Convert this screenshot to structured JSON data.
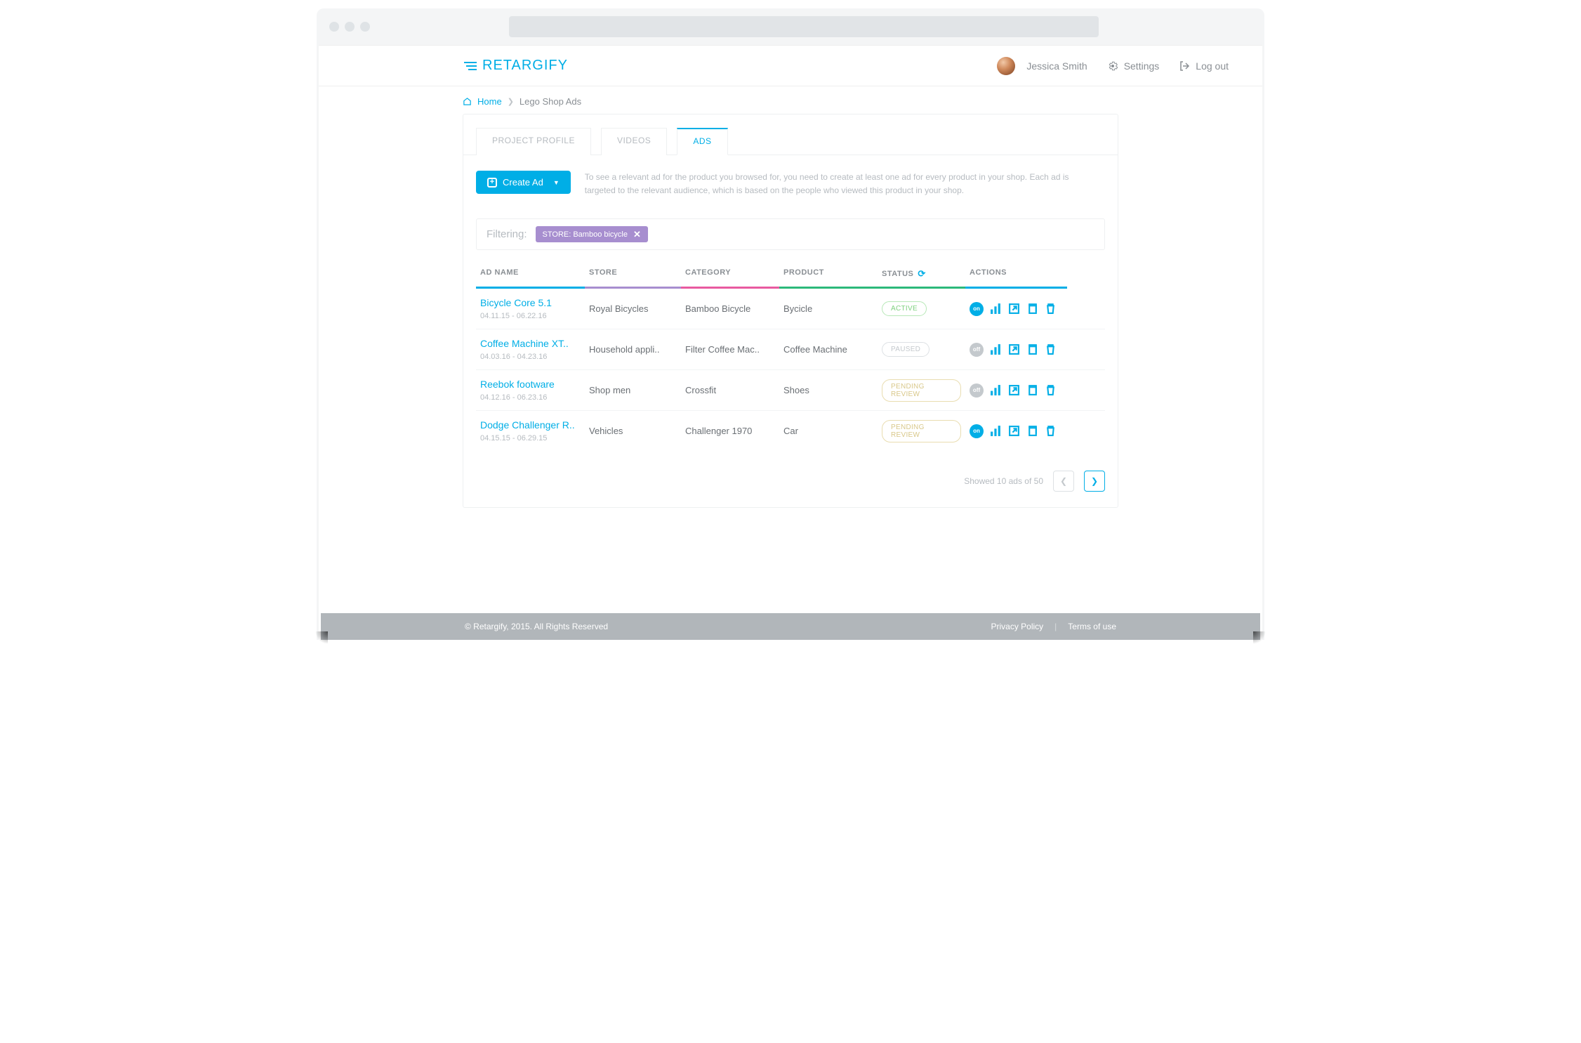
{
  "app": {
    "name": "RETARGIFY"
  },
  "user": {
    "name": "Jessica Smith"
  },
  "topnav": {
    "settings": "Settings",
    "logout": "Log out"
  },
  "breadcrumb": {
    "home": "Home",
    "current": "Lego Shop Ads"
  },
  "tabs": {
    "profile": "PROJECT PROFILE",
    "videos": "VIDEOS",
    "ads": "ADS"
  },
  "create_btn": "Create Ad",
  "help_text": "To see a relevant ad for the product you browsed for, you need to create at least one ad for every product in your shop. Each ad is targeted to the relevant audience, which is based on the people who viewed this product in your shop.",
  "filter": {
    "label": "Filtering:",
    "chip": "STORE: Bamboo bicycle"
  },
  "columns": {
    "name": "AD NAME",
    "store": "STORE",
    "category": "CATEGORY",
    "product": "PRODUCT",
    "status": "STATUS",
    "actions": "ACTIONS"
  },
  "rows": [
    {
      "name": "Bicycle Core 5.1",
      "dates": "04.11.15 - 06.22.16",
      "store": "Royal Bicycles",
      "category": "Bamboo Bicycle",
      "product": "Bycicle",
      "status": "ACTIVE",
      "status_cls": "badge-active",
      "toggle": "on"
    },
    {
      "name": "Coffee Machine XT..",
      "dates": "04.03.16 - 04.23.16",
      "store": "Household appli..",
      "category": "Filter Coffee Mac..",
      "product": "Coffee Machine",
      "status": "PAUSED",
      "status_cls": "badge-paused",
      "toggle": "off"
    },
    {
      "name": "Reebok footware",
      "dates": "04.12.16 - 06.23.16",
      "store": "Shop men",
      "category": "Crossfit",
      "product": "Shoes",
      "status": "PENDING REVIEW",
      "status_cls": "badge-pending",
      "toggle": "off"
    },
    {
      "name": "Dodge Challenger R..",
      "dates": "04.15.15 - 06.29.15",
      "store": "Vehicles",
      "category": "Challenger 1970",
      "product": "Car",
      "status": "PENDING REVIEW",
      "status_cls": "badge-pending",
      "toggle": "on"
    }
  ],
  "pager": {
    "summary": "Showed 10 ads of 50"
  },
  "footer": {
    "copyright": "© Retargify, 2015. All Rights Reserved",
    "privacy": "Privacy Policy",
    "terms": "Terms of use"
  }
}
